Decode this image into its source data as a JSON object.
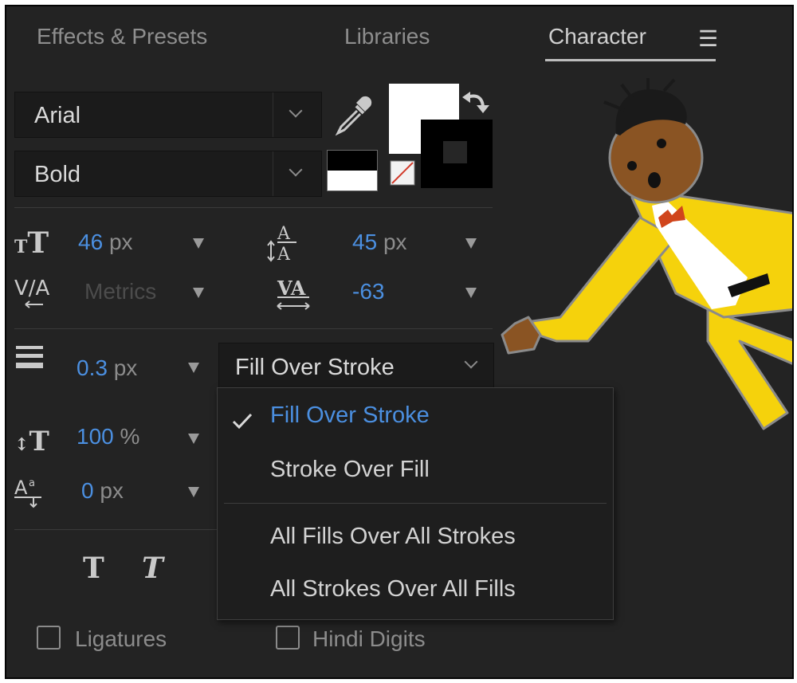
{
  "tabs": {
    "effects": "Effects & Presets",
    "libraries": "Libraries",
    "character": "Character",
    "menu_icon": "hamburger-menu-icon"
  },
  "font": {
    "family": "Arial",
    "style": "Bold"
  },
  "colors": {
    "fill": "#ffffff",
    "stroke": "#000000",
    "accent_value": "#4b8fe0",
    "panel_bg": "#232323"
  },
  "metrics": {
    "font_size": {
      "value": "46",
      "unit": "px"
    },
    "leading": {
      "value": "45",
      "unit": "px"
    },
    "kerning": {
      "value": "Metrics"
    },
    "tracking": {
      "value": "-63"
    },
    "stroke_width": {
      "value": "0.3",
      "unit": "px"
    },
    "vertical_scale": {
      "value": "100",
      "unit": "%"
    },
    "baseline_shift": {
      "value": "0",
      "unit": "px"
    }
  },
  "stroke_order": {
    "current": "Fill Over Stroke",
    "options": [
      {
        "label": "Fill Over Stroke",
        "selected": true
      },
      {
        "label": "Stroke Over Fill",
        "selected": false
      },
      {
        "label": "All Fills Over All Strokes",
        "selected": false
      },
      {
        "label": "All Strokes Over All Fills",
        "selected": false
      }
    ]
  },
  "checkboxes": {
    "ligatures": {
      "label": "Ligatures",
      "checked": false
    },
    "hindi_digits": {
      "label": "Hindi Digits",
      "checked": false
    }
  },
  "style_buttons": [
    "T",
    "T"
  ]
}
